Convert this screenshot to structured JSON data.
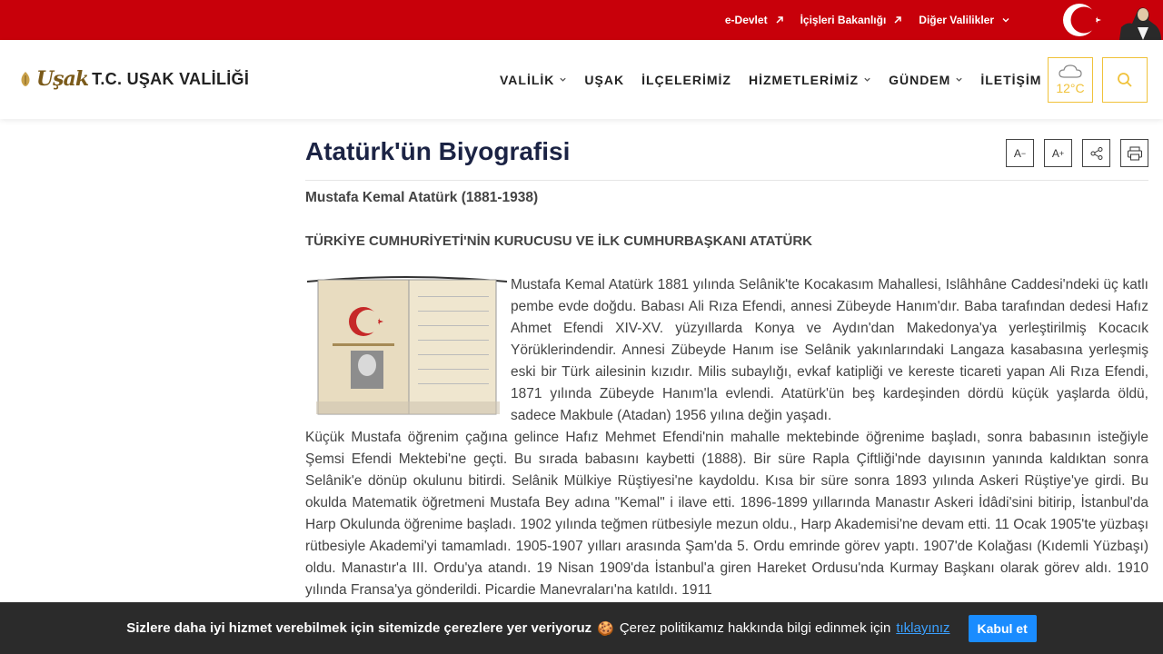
{
  "topbar": {
    "links": [
      {
        "label": "e-Devlet",
        "icon": "external-arrow-icon"
      },
      {
        "label": "İçişleri Bakanlığı",
        "icon": "external-arrow-icon"
      },
      {
        "label": "Diğer Valilikler",
        "icon": "chevron-down-icon"
      }
    ],
    "accent": "#c8000a"
  },
  "header": {
    "logo_mark": "Uşak",
    "logo_text": "T.C. UŞAK VALİLİĞİ",
    "nav": [
      {
        "label": "VALİLİK",
        "has_dropdown": true
      },
      {
        "label": "UŞAK",
        "has_dropdown": false
      },
      {
        "label": "İLÇELERİMİZ",
        "has_dropdown": false
      },
      {
        "label": "HİZMETLERİMİZ",
        "has_dropdown": true
      },
      {
        "label": "GÜNDEM",
        "has_dropdown": true
      },
      {
        "label": "İLETİŞİM",
        "has_dropdown": false
      }
    ],
    "weather_temp": "12°C",
    "accent_yellow": "#f0c23a"
  },
  "page": {
    "title": "Atatürk'ün Biyografisi",
    "tools": [
      {
        "name": "font-decrease",
        "label": "A",
        "sup": "−"
      },
      {
        "name": "font-increase",
        "label": "A",
        "sup": "+"
      },
      {
        "name": "share",
        "icon": "share-icon"
      },
      {
        "name": "print",
        "icon": "printer-icon"
      }
    ],
    "subtitle": "Mustafa Kemal Atatürk (1881-1938)",
    "heading": "TÜRKİYE CUMHURİYETİ'NİN KURUCUSU VE İLK CUMHURBAŞKANI ATATÜRK",
    "paragraph1": "Mustafa Kemal Atatürk 1881 yılında Selânik'te Kocakasım Mahallesi, Islâhhâne Caddesi'ndeki üç katlı pembe evde doğdu. Babası Ali Rıza Efendi, annesi Zübeyde Hanım'dır. Baba tarafından dedesi Hafız Ahmet Efendi XIV-XV. yüzyıllarda Konya ve Aydın'dan Makedonya'ya yerleştirilmiş Kocacık Yörüklerindendir. Annesi Zübeyde Hanım ise  Selânik yakınlarındaki Langaza kasabasına yerleşmiş eski bir Türk ailesinin kızıdır. Milis subaylığı, evkaf katipliği ve kereste ticareti yapan Ali Rıza Efendi, 1871 yılında Zübeyde Hanım'la evlendi. Atatürk'ün beş kardeşinden dördü küçük yaşlarda öldü, sadece Makbule (Atadan) 1956 yılına değin yaşadı.",
    "paragraph2": "Küçük Mustafa öğrenim çağına gelince Hafız Mehmet Efendi'nin mahalle mektebinde öğrenime başladı, sonra babasının isteğiyle Şemsi Efendi Mektebi'ne geçti. Bu sırada babasını kaybetti (1888). Bir süre Rapla Çiftliği'nde dayısının yanında kaldıktan sonra Selânik'e dönüp okulunu bitirdi. Selânik Mülkiye Rüştiyesi'ne kaydoldu. Kısa bir süre sonra 1893 yılında Askeri Rüştiye'ye girdi. Bu okulda Matematik öğretmeni Mustafa Bey adına \"Kemal\" i ilave etti. 1896-1899 yıllarında Manastır Askeri İdâdi'sini bitirip, İstanbul'da Harp Okulunda öğrenime başladı. 1902 yılında teğmen rütbesiyle mezun oldu., Harp Akademisi'ne devam etti. 11 Ocak 1905'te yüzbaşı rütbesiyle Akademi'yi tamamladı. 1905-1907 yılları arasında Şam'da 5. Ordu emrinde görev yaptı. 1907'de Kolağası (Kıdemli Yüzbaşı) oldu. Manastır'a III. Ordu'ya atandı. 19 Nisan 1909'da İstanbul'a giren Hareket Ordusu'nda Kurmay Başkanı olarak görev aldı. 1910 yılında Fransa'ya gönderildi. Picardie Manevraları'na katıldı. 1911"
  },
  "cookie": {
    "strong": "Sizlere daha iyi hizmet verebilmek için sitemizde çerezlere yer veriyoruz",
    "emoji": "🍪",
    "text": "Çerez politikamız hakkında bilgi edinmek için",
    "link": "tıklayınız",
    "button": "Kabul et"
  }
}
